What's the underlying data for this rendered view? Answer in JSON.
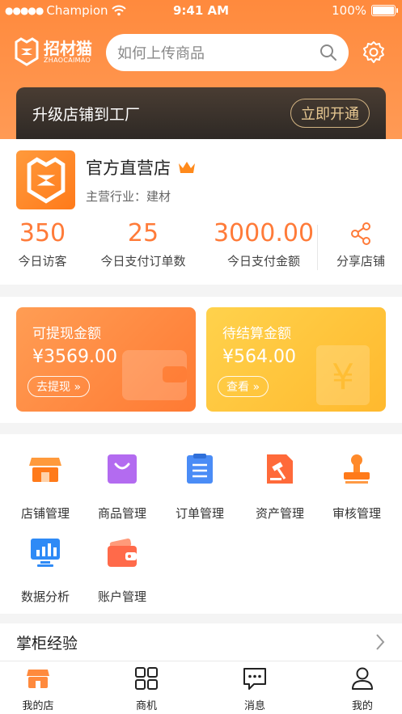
{
  "status_bar": {
    "carrier": "Champion",
    "time": "9:41 AM",
    "battery": "100%"
  },
  "header": {
    "logo_name": "招材猫",
    "logo_sub": "ZHAOCAIMAO",
    "search_placeholder": "如何上传商品"
  },
  "upgrade": {
    "text": "升级店铺到工厂",
    "button": "立即开通"
  },
  "store": {
    "name": "官方直营店",
    "industry": "主营行业：建材",
    "stats": [
      {
        "value": "350",
        "label": "今日访客"
      },
      {
        "value": "25",
        "label": "今日支付订单数"
      },
      {
        "value": "3000.00",
        "label": "今日支付金额"
      }
    ],
    "share_label": "分享店铺"
  },
  "wallets": [
    {
      "title": "可提现金额",
      "amount": "¥3569.00",
      "button": "去提现 »"
    },
    {
      "title": "待结算金额",
      "amount": "¥564.00",
      "button": "查看 »"
    }
  ],
  "menu": [
    {
      "label": "店铺管理",
      "icon": "store-icon"
    },
    {
      "label": "商品管理",
      "icon": "shopping-bag-icon"
    },
    {
      "label": "订单管理",
      "icon": "clipboard-icon"
    },
    {
      "label": "资产管理",
      "icon": "auction-document-icon"
    },
    {
      "label": "审核管理",
      "icon": "stamp-icon"
    },
    {
      "label": "数据分析",
      "icon": "bar-chart-monitor-icon"
    },
    {
      "label": "账户管理",
      "icon": "wallet-icon"
    }
  ],
  "experience": {
    "title": "掌柜经验"
  },
  "tabbar": [
    {
      "label": "我的店",
      "icon": "store-icon",
      "active": true
    },
    {
      "label": "商机",
      "icon": "grid-icon",
      "active": false
    },
    {
      "label": "消息",
      "icon": "message-icon",
      "active": false
    },
    {
      "label": "我的",
      "icon": "user-icon",
      "active": false
    }
  ],
  "colors": {
    "brand": "#ff8a3d",
    "accent": "#ff7b39",
    "gold": "#ffc23d"
  }
}
